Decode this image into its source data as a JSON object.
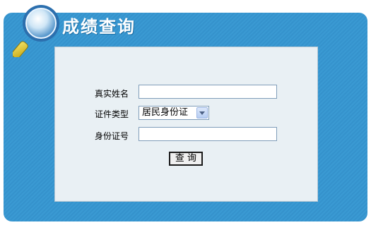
{
  "header": {
    "title": "成绩查询"
  },
  "form": {
    "name_label": "真实姓名",
    "name_value": "",
    "id_type_label": "证件类型",
    "id_type_selected": "居民身份证",
    "id_number_label": "身份证号",
    "id_number_value": "",
    "query_button": "查 询"
  },
  "colors": {
    "frame": "#3a9ad3",
    "panel": "#e9f0f4"
  },
  "icons": {
    "logo": "magnifier-icon",
    "select_arrow": "chevron-down-icon"
  }
}
